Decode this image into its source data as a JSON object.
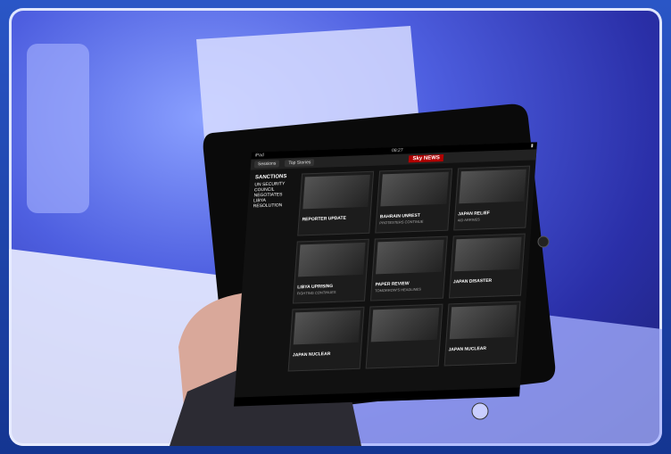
{
  "ipad": {
    "status_left": "iPad",
    "status_time": "08:27",
    "tabs": [
      "Sessions",
      "Top Stories"
    ],
    "brand": "Sky NEWS",
    "sidebar": {
      "title": "SANCTIONS",
      "lines": [
        "UN SECURITY",
        "COUNCIL",
        "NEGOTIATES",
        "LIBYA",
        "RESOLUTION"
      ]
    },
    "tiles": [
      {
        "caption": "REPORTER UPDATE",
        "desc": ""
      },
      {
        "caption": "BAHRAIN UNREST",
        "desc": "PROTESTERS CONTINUE"
      },
      {
        "caption": "JAPAN RELIEF",
        "desc": "AID ARRIVES"
      },
      {
        "caption": "LIBYA UPRISING",
        "desc": "FIGHTING CONTINUES"
      },
      {
        "caption": "PAPER REVIEW",
        "desc": "TOMORROW'S HEADLINES"
      },
      {
        "caption": "JAPAN DISASTER",
        "desc": ""
      },
      {
        "caption": "JAPAN NUCLEAR",
        "desc": ""
      },
      {
        "caption": "",
        "desc": ""
      },
      {
        "caption": "JAPAN NUCLEAR",
        "desc": ""
      }
    ]
  },
  "colors": {
    "frame": "#1a3e9a",
    "accent": "#b00000"
  }
}
